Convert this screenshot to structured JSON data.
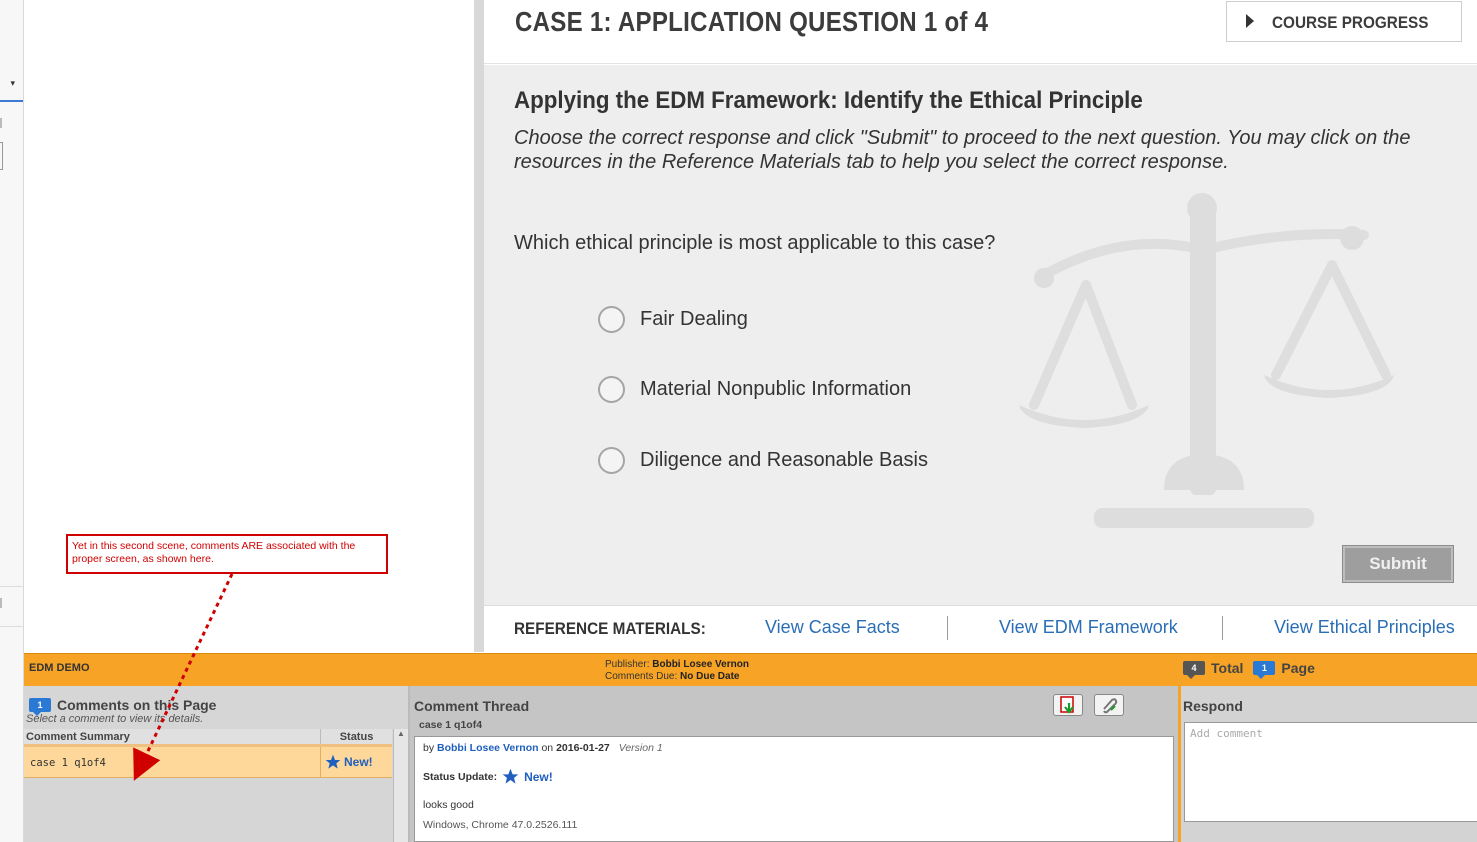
{
  "course": {
    "case_title": "CASE 1: APPLICATION QUESTION 1 of 4",
    "progress_label": "COURSE PROGRESS"
  },
  "content": {
    "title": "Applying the EDM Framework: Identify the Ethical Principle",
    "instructions": "Choose the correct response and click \"Submit\" to proceed to the next question. You may click on the resources in the Reference Materials tab to help you select the correct response.",
    "question": "Which ethical principle is most applicable to this case?",
    "options": [
      "Fair Dealing",
      "Material Nonpublic Information",
      "Diligence and Reasonable Basis"
    ],
    "submit_label": "Submit"
  },
  "reference": {
    "label": "REFERENCE MATERIALS:",
    "links": [
      "View Case Facts",
      "View EDM Framework",
      "View Ethical Principles"
    ]
  },
  "annotation": {
    "text": "Yet in this second scene, comments ARE associated with the proper screen, as shown here.",
    "color": "#d00000"
  },
  "review": {
    "project": "EDM DEMO",
    "publisher_label": "Publisher:",
    "publisher": "Bobbi Losee Vernon",
    "due_label": "Comments Due:",
    "due": "No Due Date",
    "total_count": "4",
    "total_label": "Total",
    "page_count": "1",
    "page_label": "Page",
    "accent_color": "#f7a325",
    "comments_panel": {
      "badge": "1",
      "title": "Comments on this Page",
      "subtitle": "Select a comment to view its details.",
      "col_summary": "Comment Summary",
      "col_status": "Status",
      "rows": [
        {
          "summary": "case 1 q1of4",
          "status": "New!"
        }
      ]
    },
    "thread": {
      "title": "Comment Thread",
      "subject": "case 1 q1of4",
      "by": "by",
      "author": "Bobbi Losee Vernon",
      "on": "on",
      "date": "2016-01-27",
      "version": "Version 1",
      "status_label": "Status Update:",
      "status_value": "New!",
      "body": "looks good",
      "meta": "Windows, Chrome 47.0.2526.111",
      "icons": [
        "pdf-download-icon",
        "attachment-icon"
      ]
    },
    "respond": {
      "title": "Respond",
      "placeholder": "Add comment"
    }
  }
}
